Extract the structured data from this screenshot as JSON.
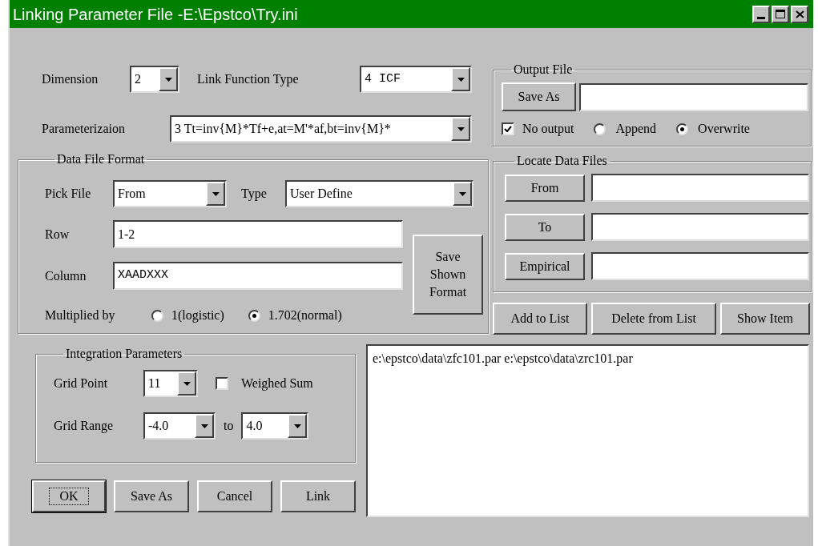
{
  "window": {
    "title": "Linking Parameter File -E:\\Epstco\\Try.ini"
  },
  "dimension": {
    "label": "Dimension",
    "value": "2"
  },
  "link_function_type": {
    "label": "Link Function Type",
    "value": "4 ICF"
  },
  "parameterization": {
    "label": "Parameterizaion",
    "value": "3 Tt=inv{M}*Tf+e,at=M'*af,bt=inv{M}*"
  },
  "data_file_format": {
    "title": "Data File Format",
    "pick_file": {
      "label": "Pick File",
      "value": "From"
    },
    "type": {
      "label": "Type",
      "value": "User Define"
    },
    "row": {
      "label": "Row",
      "value": "1-2"
    },
    "column": {
      "label": "Column",
      "value": "XAADXXX"
    },
    "multiplied_by": {
      "label": "Multiplied by",
      "options": [
        {
          "label": "1(logistic)",
          "selected": false
        },
        {
          "label": "1.702(normal)",
          "selected": true
        }
      ]
    },
    "save_button": [
      "Save",
      "Shown",
      "Format"
    ]
  },
  "output_file": {
    "title": "Output File",
    "save_button": "Save As",
    "no_output": {
      "label": "No output",
      "checked": true
    },
    "modes": [
      {
        "label": "Append",
        "selected": false
      },
      {
        "label": "Overwrite",
        "selected": true
      }
    ]
  },
  "locate_data_files": {
    "title": "Locate Data Files",
    "buttons": [
      "From",
      "To",
      "Empirical"
    ]
  },
  "list_buttons": [
    "Add to List",
    "Delete from List",
    "Show Item"
  ],
  "integration": {
    "title": "Integration Parameters",
    "grid_point": {
      "label": "Grid Point",
      "value": "11"
    },
    "weighed_sum": {
      "label": "Weighed Sum",
      "checked": false
    },
    "grid_range": {
      "label": "Grid Range",
      "from": "-4.0",
      "to_label": "to",
      "to": "4.0"
    }
  },
  "dialog_buttons": [
    {
      "label": "OK",
      "default": true
    },
    {
      "label": "Save As",
      "default": false
    },
    {
      "label": "Cancel",
      "default": false
    },
    {
      "label": "Link",
      "default": false
    }
  ],
  "file_list": {
    "items": [
      "e:\\epstco\\data\\zfc101.par e:\\epstco\\data\\zrc101.par"
    ]
  }
}
